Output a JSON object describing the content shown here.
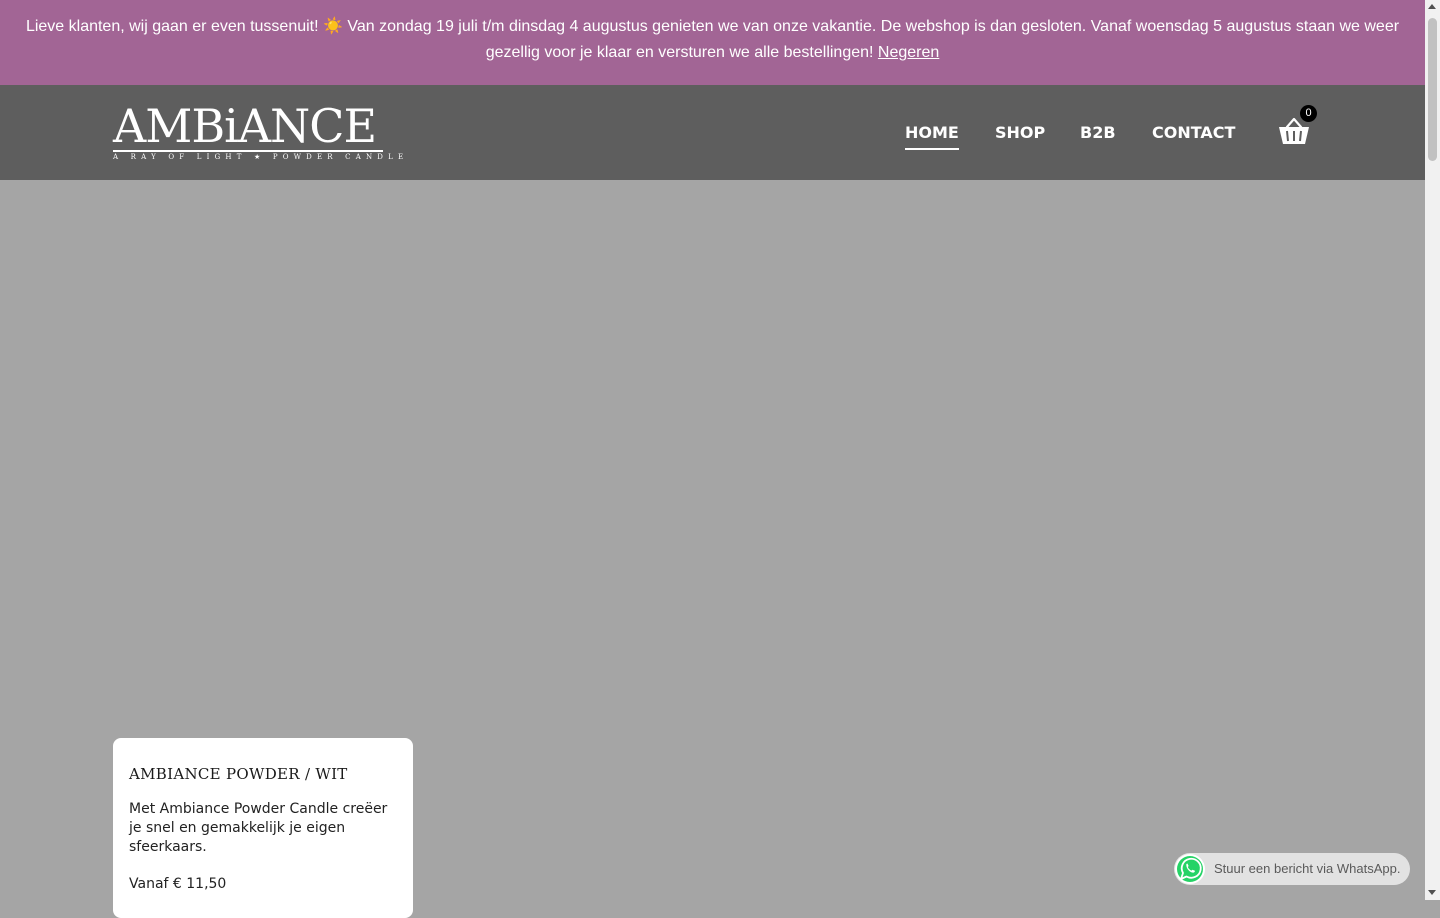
{
  "notice": {
    "text": "Lieve klanten, wij gaan er even tussenuit! ☀️ Van zondag 19 juli t/m dinsdag 4 augustus genieten we van onze vakantie. De webshop is dan gesloten. Vanaf woensdag 5 augustus staan we weer gezellig voor je klaar en versturen we alle bestellingen!",
    "dismiss_label": "Negeren",
    "bg_color": "#a26595"
  },
  "header": {
    "logo": {
      "name": "AMBiANCE",
      "tagline": "A RAY OF LIGHT ★ POWDER CANDLE"
    },
    "nav": [
      {
        "label": "HOME",
        "active": true
      },
      {
        "label": "SHOP",
        "active": false
      },
      {
        "label": "B2B",
        "active": false
      },
      {
        "label": "CONTACT",
        "active": false
      }
    ],
    "cart": {
      "icon": "basket-icon",
      "count": "0"
    },
    "bg_color": "#5e5e5e"
  },
  "product_card": {
    "title": "AMBIANCE POWDER / WIT",
    "description": "Met Ambiance Powder Candle creëer je snel en gemakkelijk je eigen sfeerkaars.",
    "price": "Vanaf € 11,50"
  },
  "whatsapp": {
    "icon": "whatsapp-icon",
    "label": "Stuur een bericht via WhatsApp."
  }
}
